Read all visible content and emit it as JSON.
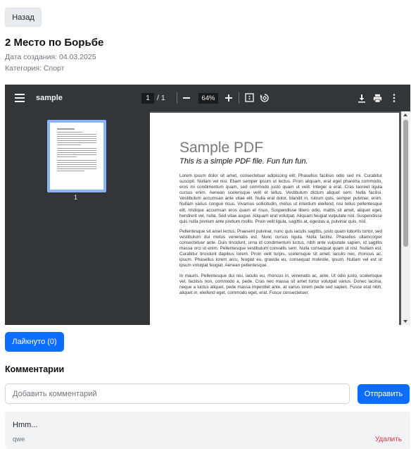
{
  "nav": {
    "back_label": "Назад"
  },
  "document": {
    "title": "2 Место по Борьбе",
    "created": "Дата создания: 04.03.2025",
    "category": "Категория: Спорт"
  },
  "viewer": {
    "file_name": "sample",
    "current_page": "1",
    "total_pages": "/ 1",
    "zoom": "64%",
    "thumbnail_label": "1",
    "icons": [
      "menu-icon",
      "zoom-out-icon",
      "zoom-in-icon",
      "fit-page-icon",
      "rotate-icon",
      "download-icon",
      "print-icon",
      "more-icon"
    ],
    "page": {
      "heading": "Sample PDF",
      "subheading": "This is a simple PDF file. Fun fun fun.",
      "paragraphs": [
        "Lorem ipsum dolor sit amet, consectetuer adipiscing elit. Phasellus facilisis odio sed mi. Curabitur suscipit. Nullam vel nisi. Etiam semper ipsum ut lectus. Proin aliquam, erat eget pharetra commodo, eros mi condimentum quam, sed commodo justo quam ut velit. Integer a erat. Cras laoreet ligula cursus enim. Aenean scelerisque velit et tellus. Vestibulum dictum aliquet sem. Nulla facilisi. Vestibulum accumsan ante vitae elit. Nulla erat dolor, blandit in, rutrum quis, semper pulvinar, enim. Nullam varius congue risus. Vivamus sollicitudin, metus ut interdum eleifend, nisi tellus pellentesque elit, tristique accumsan eros quam et risus. Suspendisse libero odio, mattis sit amet, aliquet eget, hendrerit vel, nulla. Sed vitae augue. Aliquam erat volutpat. Aliquam feugiat vulputate nisl. Suspendisse quis nulla pretium ante pretium mollis. Proin velit ligula, sagittis at, egestas a, pulvinar quis, nisl.",
        "Pellentesque sit amet lectus. Praesent pulvinar, nunc quis iaculis sagittis, justo quam lobortis tortor, sed vestibulum dui metus venenatis est. Nunc cursus ligula. Nulla facilisi. Phasellus ullamcorper consectetuer ante. Duis tincidunt, urna id condimentum luctus, nibh ante vulputate sapien, id sagittis massa orci ut enim. Pellentesque vestibulum convallis sem. Nulla consequat quam ut nisl. Nullam est. Curabitur tincidunt dapibus lorem. Proin velit turpis, scelerisque sit amet, iaculis nec, rhoncus ac, ipsum. Phasellus lorem arcu, feugiat eu, gravida eu, consequat molestie, ipsum. Nullam vel est ut ipsum volutpat feugiat. Aenean pellentesque.",
        "In mauris. Pellentesque dui nisi, iaculis eu, rhoncus in, venenatis ac, ante. Ut odio justo, scelerisque vel, facilisis non, commodo a, pede. Cras nec massa sit amet tortor volutpat varius. Donec lacinia, neque a luctus aliquet, pede massa imperdiet ante, at varius lorem pede sed sapien. Fusce erat nibh, aliquet in, eleifend eget, commodo eget, erat. Fusce consectetuer."
      ]
    }
  },
  "actions": {
    "like_label": "Лайкнуто (0)"
  },
  "comments": {
    "title": "Комментарии",
    "input_placeholder": "Добавить комментарий",
    "send_label": "Отправить",
    "items": [
      {
        "text": "Hmm...",
        "author": "qwe",
        "delete_label": "Удалить"
      }
    ]
  },
  "colors": {
    "primary": "#0d6efd",
    "danger": "#dc3545",
    "viewer_toolbar": "#323639",
    "viewer_bg": "#525659",
    "thumb_border": "#8ab4f8"
  }
}
